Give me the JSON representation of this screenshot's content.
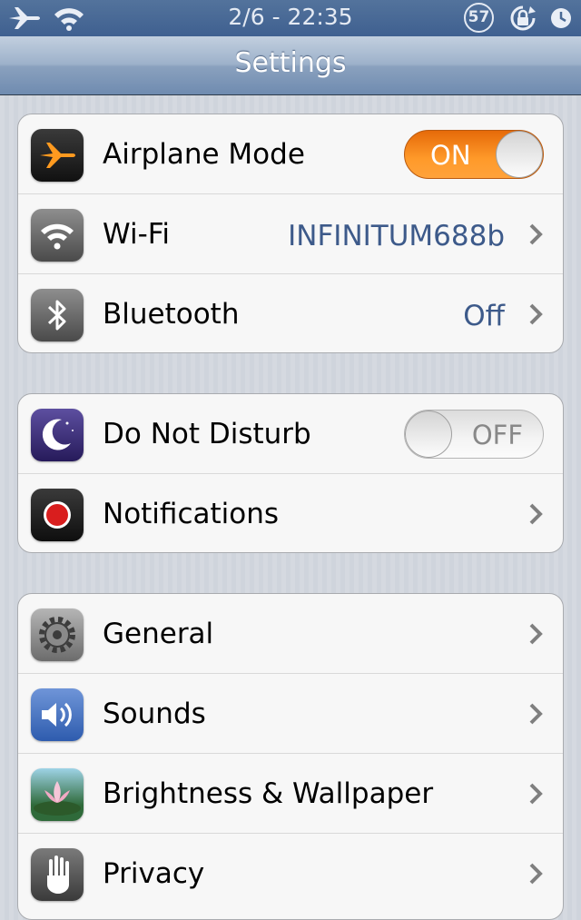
{
  "status_bar": {
    "time": "2/6 - 22:35",
    "badge": "57",
    "icons": [
      "airplane-icon",
      "wifi-icon",
      "rotation-lock-icon",
      "clock-icon"
    ]
  },
  "nav": {
    "title": "Settings"
  },
  "groups": [
    {
      "rows": [
        {
          "label": "Airplane Mode",
          "icon": "airplane-mode-icon",
          "switch": "ON"
        },
        {
          "label": "Wi-Fi",
          "icon": "wifi-settings-icon",
          "value": "INFINITUM688b"
        },
        {
          "label": "Bluetooth",
          "icon": "bluetooth-icon",
          "value": "Off"
        }
      ]
    },
    {
      "rows": [
        {
          "label": "Do Not Disturb",
          "icon": "moon-icon",
          "switch": "OFF"
        },
        {
          "label": "Notifications",
          "icon": "notifications-icon"
        }
      ]
    },
    {
      "rows": [
        {
          "label": "General",
          "icon": "gear-icon"
        },
        {
          "label": "Sounds",
          "icon": "speaker-icon"
        },
        {
          "label": "Brightness & Wallpaper",
          "icon": "flower-icon"
        },
        {
          "label": "Privacy",
          "icon": "hand-icon"
        }
      ]
    }
  ],
  "colors": {
    "switch_on": "#ff8c1a",
    "value_text": "#3d5a8a",
    "status_bar": "#4a6a95"
  }
}
